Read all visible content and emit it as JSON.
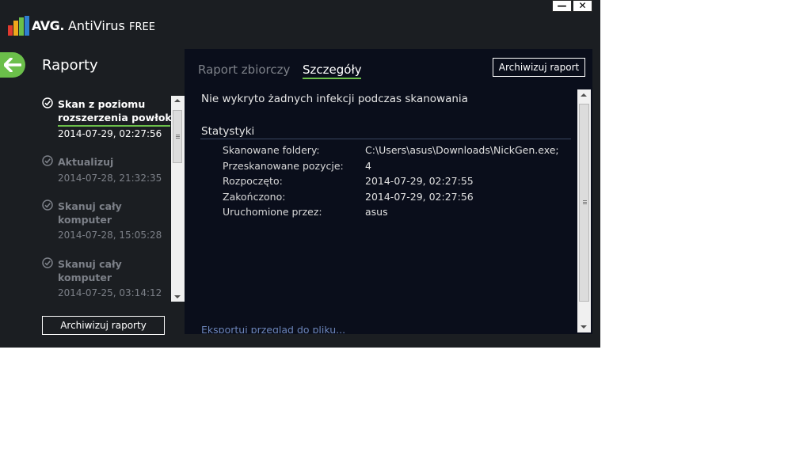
{
  "window": {
    "brand": "AVG.",
    "product": "AntiVirus",
    "edition": "FREE",
    "minimize_symbol": "—",
    "close_symbol": "✕"
  },
  "icons": {
    "logo": "avg-logo-icon",
    "back": "arrow-left-icon",
    "check": "check-circle-icon"
  },
  "colors": {
    "window_bg": "#1b1e22",
    "panel_bg": "#0a0e1b",
    "accent": "#6bbf4a",
    "link": "#6b84b8"
  },
  "sidebar": {
    "title": "Raporty",
    "reports": [
      {
        "name_line1": "Skan z poziomu",
        "name_line2": "rozszerzenia powłoki",
        "date": "2014-07-29, 02:27:56",
        "active": true
      },
      {
        "name_line1": "Aktualizuj",
        "name_line2": "",
        "date": "2014-07-28, 21:32:35",
        "active": false
      },
      {
        "name_line1": "Skanuj cały",
        "name_line2": "komputer",
        "date": "2014-07-28, 15:05:28",
        "active": false
      },
      {
        "name_line1": "Skanuj cały",
        "name_line2": "komputer",
        "date": "2014-07-25, 03:14:12",
        "active": false
      }
    ],
    "archive_all_label": "Archiwizuj raporty"
  },
  "main": {
    "tabs": [
      {
        "label": "Raport zbiorczy",
        "selected": false
      },
      {
        "label": "Szczegóły",
        "selected": true
      }
    ],
    "archive_report_label": "Archiwizuj raport",
    "summary_text": "Nie wykryto żadnych infekcji podczas skanowania",
    "stats_title": "Statystyki",
    "stats": [
      {
        "label": "Skanowane foldery:",
        "value": "C:\\Users\\asus\\Downloads\\NickGen.exe;"
      },
      {
        "label": "Przeskanowane pozycje:",
        "value": "4"
      },
      {
        "label": "Rozpoczęto:",
        "value": "2014-07-29, 02:27:55"
      },
      {
        "label": "Zakończono:",
        "value": "2014-07-29, 02:27:56"
      },
      {
        "label": "Uruchomione przez:",
        "value": "asus"
      }
    ],
    "export_link": "Eksportuj przegląd do pliku..."
  }
}
